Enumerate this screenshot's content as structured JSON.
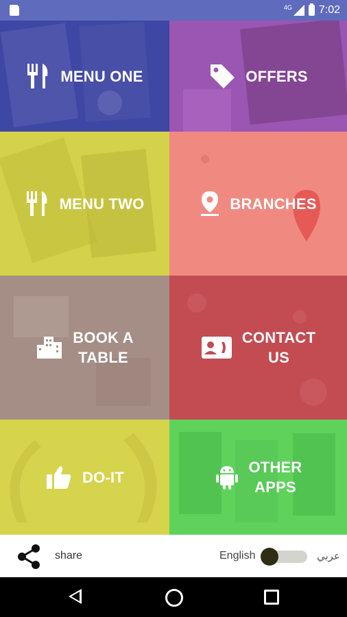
{
  "status_bar": {
    "network": "4G",
    "time": "7:02"
  },
  "tiles": [
    {
      "label_lines": [
        "MENU ONE"
      ],
      "icon": "fork-knife-icon"
    },
    {
      "label_lines": [
        "OFFERS"
      ],
      "icon": "tag-icon"
    },
    {
      "label_lines": [
        "MENU TWO"
      ],
      "icon": "fork-knife-icon"
    },
    {
      "label_lines": [
        "BRANCHES"
      ],
      "icon": "location-pin-icon"
    },
    {
      "label_lines": [
        "BOOK A",
        "TABLE"
      ],
      "icon": "building-icon"
    },
    {
      "label_lines": [
        "CONTACT",
        "US"
      ],
      "icon": "contact-card-icon"
    },
    {
      "label_lines": [
        "DO-IT"
      ],
      "icon": "thumbs-up-icon"
    },
    {
      "label_lines": [
        "OTHER",
        "APPS"
      ],
      "icon": "android-icon"
    }
  ],
  "bottom_bar": {
    "share_label": "share",
    "language_left": "English",
    "language_right": "عربي",
    "toggle_state": "English"
  },
  "colors": {
    "status_bar": "#5f6bbd",
    "menu_one": "#3f47a4",
    "offers": "#9a56b2",
    "menu_two": "#d4d24a",
    "branches": "#f08a80",
    "book_table": "#a58e86",
    "contact_us": "#c34b52",
    "do_it": "#d6d34c",
    "other_apps": "#5fd25c"
  }
}
